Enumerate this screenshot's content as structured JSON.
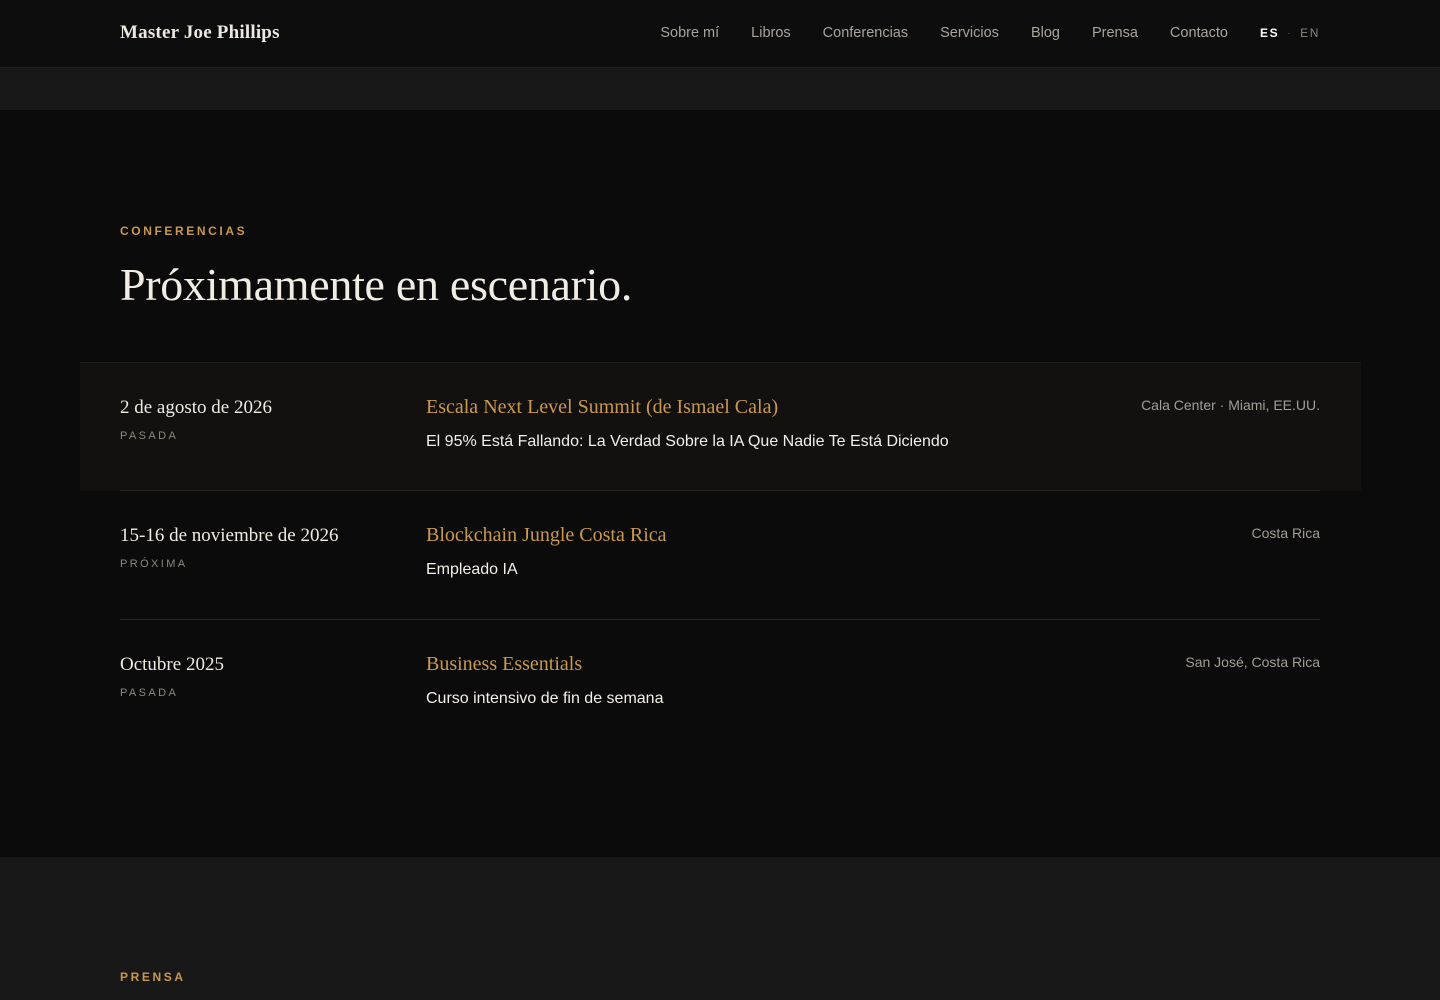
{
  "header": {
    "brand": "Master Joe Phillips",
    "nav": [
      "Sobre mí",
      "Libros",
      "Conferencias",
      "Servicios",
      "Blog",
      "Prensa",
      "Contacto"
    ],
    "lang_active": "ES",
    "lang_inactive": "EN"
  },
  "conferences": {
    "eyebrow": "CONFERENCIAS",
    "heading": "Próximamente en escenario.",
    "events": [
      {
        "date": "2 de agosto de 2026",
        "status": "PASADA",
        "name": "Escala Next Level Summit (de Ismael Cala)",
        "talk": "El 95% Está Fallando: La Verdad Sobre la IA Que Nadie Te Está Diciendo",
        "location": "Cala Center · Miami, EE.UU."
      },
      {
        "date": "15-16 de noviembre de 2026",
        "status": "PRÓXIMA",
        "name": "Blockchain Jungle Costa Rica",
        "talk": "Empleado IA",
        "location": "Costa Rica"
      },
      {
        "date": "Octubre 2025",
        "status": "PASADA",
        "name": "Business Essentials",
        "talk": "Curso intensivo de fin de semana",
        "location": "San José, Costa Rica"
      }
    ]
  },
  "press": {
    "eyebrow": "PRENSA"
  },
  "colors": {
    "accent": "#c8984f",
    "background": "#0b0b0b",
    "band": "#181818"
  }
}
